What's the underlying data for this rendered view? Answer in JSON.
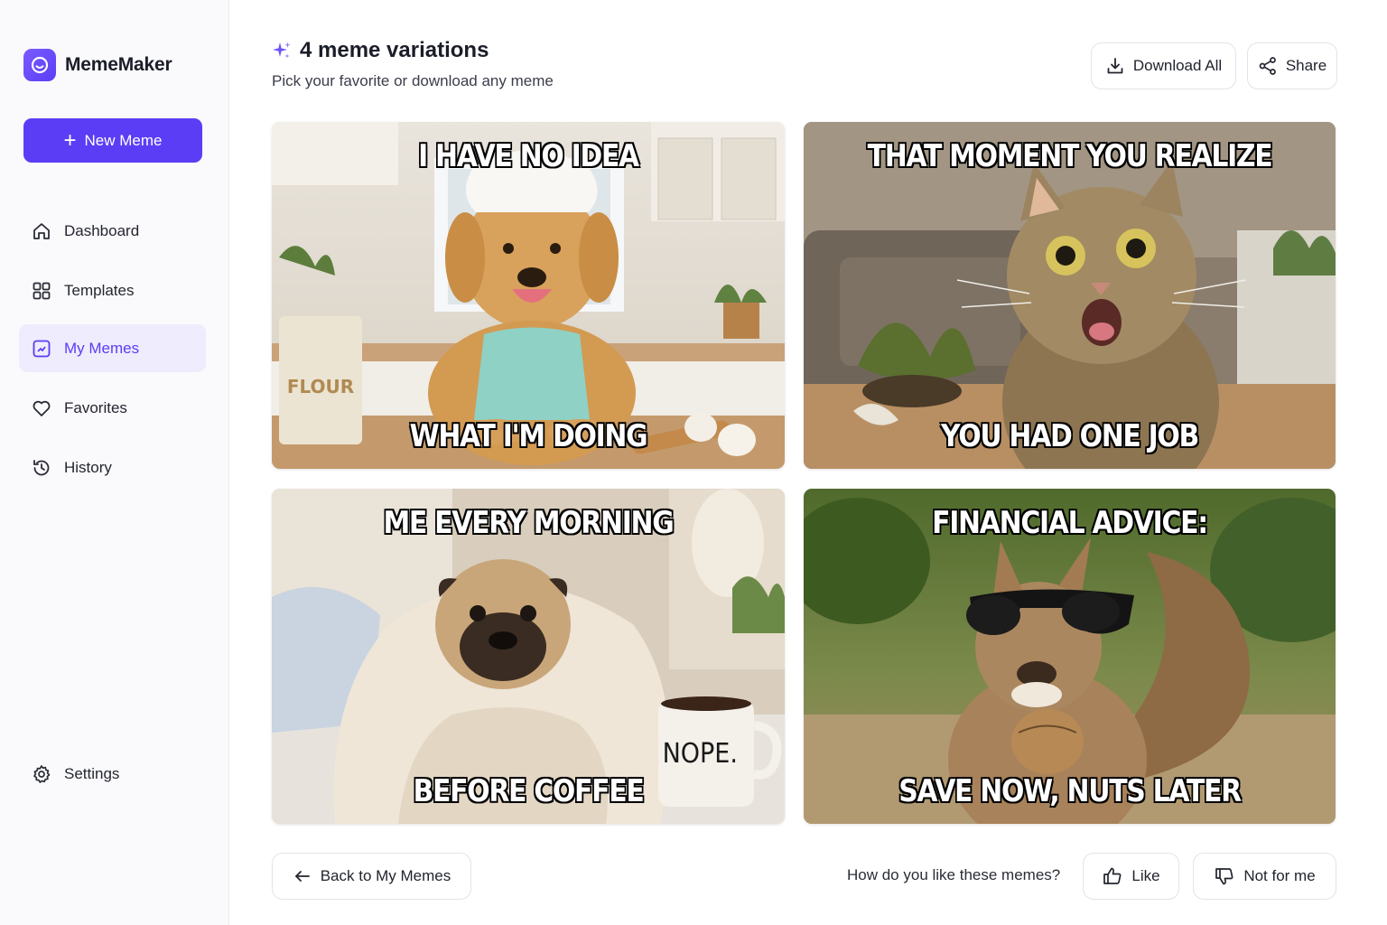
{
  "app": {
    "name": "MemeMaker",
    "accent": "#5b3df5"
  },
  "sidebar": {
    "new_button": "New Meme",
    "items": [
      {
        "label": "Dashboard",
        "icon": "home-icon"
      },
      {
        "label": "Templates",
        "icon": "templates-icon"
      },
      {
        "label": "My Memes",
        "icon": "my-memes-icon",
        "active": true
      },
      {
        "label": "Favorites",
        "icon": "heart-icon"
      },
      {
        "label": "History",
        "icon": "history-icon"
      }
    ],
    "settings": "Settings"
  },
  "header": {
    "title": "4 meme variations",
    "subtitle": "Pick your favorite or download any meme",
    "download_all": "Download All",
    "share": "Share"
  },
  "memes": [
    {
      "top": "I HAVE NO IDEA",
      "bottom": "WHAT I'M DOING",
      "subject": "golden retriever in chef hat baking",
      "prop_text": "FLOUR"
    },
    {
      "top": "THAT MOMENT YOU REALIZE",
      "bottom": "YOU HAD ONE JOB",
      "subject": "shocked tabby cat with knocked-over plant"
    },
    {
      "top": "ME EVERY MORNING",
      "bottom": "BEFORE COFFEE",
      "subject": "pug wrapped in blanket with mug",
      "prop_text": "NOPE."
    },
    {
      "top": "FINANCIAL ADVICE:",
      "bottom": "SAVE NOW, NUTS LATER",
      "subject": "squirrel in sunglasses holding walnut"
    }
  ],
  "footer": {
    "back": "Back to My Memes",
    "question": "How do you like these memes?",
    "like": "Like",
    "dislike": "Not for me"
  }
}
